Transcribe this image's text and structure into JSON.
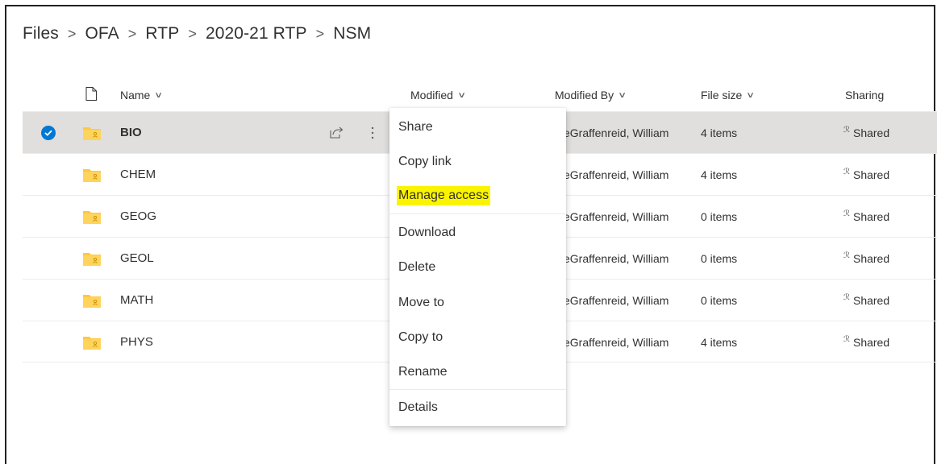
{
  "breadcrumb": [
    "Files",
    "OFA",
    "RTP",
    "2020-21 RTP",
    "NSM"
  ],
  "breadcrumb_separator": ">",
  "columns": {
    "name": "Name",
    "modified": "Modified",
    "modified_by": "Modified By",
    "file_size": "File size",
    "sharing": "Sharing"
  },
  "rows": [
    {
      "name": "BIO",
      "modified_by": "eGraffenreid, William",
      "file_size": "4 items",
      "sharing": "Shared",
      "selected": true
    },
    {
      "name": "CHEM",
      "modified_by": "eGraffenreid, William",
      "file_size": "4 items",
      "sharing": "Shared"
    },
    {
      "name": "GEOG",
      "modified_by": "eGraffenreid, William",
      "file_size": "0 items",
      "sharing": "Shared"
    },
    {
      "name": "GEOL",
      "modified_by": "eGraffenreid, William",
      "file_size": "0 items",
      "sharing": "Shared"
    },
    {
      "name": "MATH",
      "modified_by": "eGraffenreid, William",
      "file_size": "0 items",
      "sharing": "Shared"
    },
    {
      "name": "PHYS",
      "modified_by": "eGraffenreid, William",
      "file_size": "4 items",
      "sharing": "Shared"
    }
  ],
  "context_menu": [
    {
      "label": "Share"
    },
    {
      "label": "Copy link"
    },
    {
      "label": "Manage access",
      "highlighted": true
    },
    {
      "label": "Download"
    },
    {
      "label": "Delete"
    },
    {
      "label": "Move to"
    },
    {
      "label": "Copy to"
    },
    {
      "label": "Rename"
    },
    {
      "label": "Details"
    }
  ],
  "colors": {
    "accent": "#0078d4",
    "folder": "#ffc83d",
    "highlight": "#fbf400",
    "selected_row": "#e1dfdd"
  },
  "icons": {
    "file_header": "document-icon",
    "folder": "shared-folder-icon",
    "share": "share-icon",
    "more": "more-vertical-icon",
    "shared": "people-icon"
  }
}
